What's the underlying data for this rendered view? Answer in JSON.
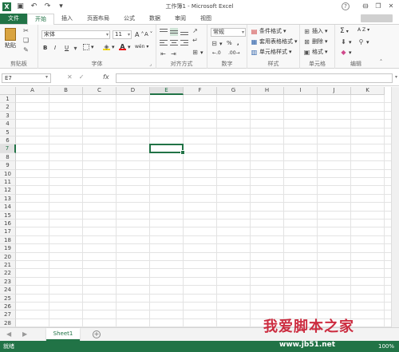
{
  "window": {
    "title": "工作簿1 - Microsoft Excel",
    "logo": "X",
    "help": "?",
    "controls": [
      "—",
      "❐",
      "✕"
    ]
  },
  "tabs": [
    {
      "label": "文件"
    },
    {
      "label": "开始"
    },
    {
      "label": "插入"
    },
    {
      "label": "页面布局"
    },
    {
      "label": "公式"
    },
    {
      "label": "数据"
    },
    {
      "label": "审阅"
    },
    {
      "label": "视图"
    }
  ],
  "ribbon": {
    "clipboard": {
      "paste": "粘贴",
      "label": "剪贴板"
    },
    "font": {
      "font_name": "宋体",
      "font_size": "11",
      "bold": "B",
      "italic": "I",
      "underline": "U",
      "grow": "A",
      "shrink": "A",
      "wen": "wén",
      "label": "字体"
    },
    "alignment": {
      "label": "对齐方式"
    },
    "number": {
      "format": "常规",
      "percent": "%",
      "comma": ",",
      "label": "数字"
    },
    "styles": {
      "conditional": "条件格式",
      "table": "套用表格格式",
      "cell": "单元格样式",
      "label": "样式"
    },
    "cells": {
      "insert": "插入",
      "delete": "删除",
      "format": "格式",
      "label": "单元格"
    },
    "editing": {
      "sum": "Σ",
      "sort": "A Z",
      "label": "编辑"
    }
  },
  "formula_bar": {
    "name_box": "E7",
    "fx": "fx",
    "cancel": "✕",
    "enter": "✓",
    "value": ""
  },
  "grid": {
    "columns": [
      "A",
      "B",
      "C",
      "D",
      "E",
      "F",
      "G",
      "H",
      "I",
      "J",
      "K"
    ],
    "rows": [
      "1",
      "2",
      "3",
      "4",
      "5",
      "6",
      "7",
      "8",
      "9",
      "10",
      "11",
      "12",
      "13",
      "14",
      "15",
      "16",
      "17",
      "18",
      "19",
      "20",
      "21",
      "22",
      "23",
      "24",
      "25",
      "26",
      "27",
      "28"
    ],
    "selected_cell": "E7",
    "selected_column": "E",
    "selected_row": "7"
  },
  "sheets": {
    "tabs": [
      "Sheet1"
    ],
    "add": "+",
    "nav_prev": "◀",
    "nav_next": "▶"
  },
  "status": {
    "ready": "就绪",
    "zoom": "100%"
  },
  "watermark": {
    "text_red": "我爱脚本之家",
    "url": "www.jb51.net"
  },
  "colors": {
    "accent": "#217346"
  }
}
